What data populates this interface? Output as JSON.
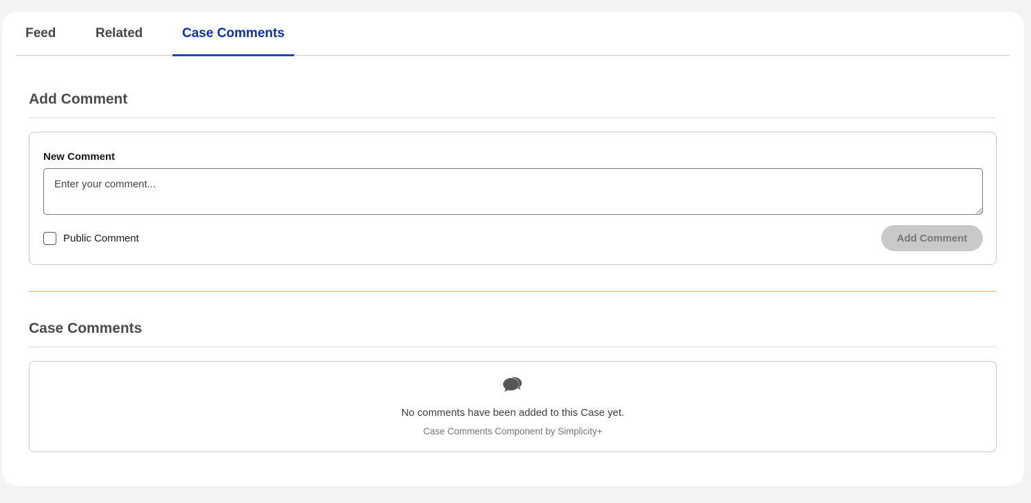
{
  "tabs": [
    {
      "label": "Feed",
      "active": false
    },
    {
      "label": "Related",
      "active": false
    },
    {
      "label": "Case Comments",
      "active": true
    }
  ],
  "add_comment": {
    "title": "Add Comment",
    "field_label": "New Comment",
    "placeholder": "Enter your comment...",
    "value": "",
    "public_checkbox_label": "Public Comment",
    "public_checked": false,
    "submit_label": "Add Comment",
    "submit_disabled": true
  },
  "case_comments": {
    "title": "Case Comments",
    "icon": "chat-bubbles-icon",
    "empty_message": "No comments have been added to this Case yet.",
    "footer_note": "Case Comments Component by Simplicity+"
  },
  "colors": {
    "active_tab": "#0b2fb5",
    "divider_accent": "#f4a96a",
    "button_disabled_bg": "#c9c9c9"
  }
}
